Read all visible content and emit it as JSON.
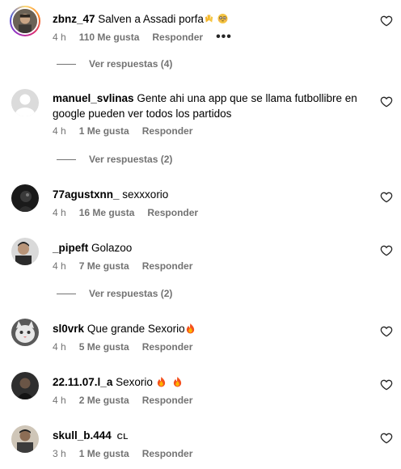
{
  "comments": [
    {
      "username": "zbnz_47",
      "text": "Salven a Assadi porfa",
      "time": "4 h",
      "likes": "110 Me gusta",
      "reply": "Responder",
      "more": "•••",
      "view_replies": "Ver respuestas (4)"
    },
    {
      "username": "manuel_svlinas",
      "text": "Gente ahi una app que se llama futbollibre en google pueden ver todos los partidos",
      "time": "4 h",
      "likes": "1 Me gusta",
      "reply": "Responder",
      "view_replies": "Ver respuestas (2)"
    },
    {
      "username": "77agustxnn_",
      "text": "sexxxorio",
      "time": "4 h",
      "likes": "16 Me gusta",
      "reply": "Responder"
    },
    {
      "username": "_pipeft",
      "text": "Golazoo",
      "time": "4 h",
      "likes": "7 Me gusta",
      "reply": "Responder",
      "view_replies": "Ver respuestas (2)"
    },
    {
      "username": "sl0vrk",
      "text": "Que grande Sexorio",
      "time": "4 h",
      "likes": "5 Me gusta",
      "reply": "Responder"
    },
    {
      "username": "22.11.07.l_a",
      "text": "Sexorio",
      "time": "4 h",
      "likes": "2 Me gusta",
      "reply": "Responder"
    },
    {
      "username": "skull_b.444",
      "badge": "CL",
      "text": "",
      "time": "3 h",
      "likes": "1 Me gusta",
      "reply": "Responder"
    }
  ],
  "icons": {
    "like": "heart-outline-icon",
    "fire": "fire-emoji",
    "hands": "raised-hands-emoji",
    "face": "flushed-face-emoji"
  },
  "colors": {
    "meta_text": "#737373",
    "story_ring": "#d62976"
  }
}
